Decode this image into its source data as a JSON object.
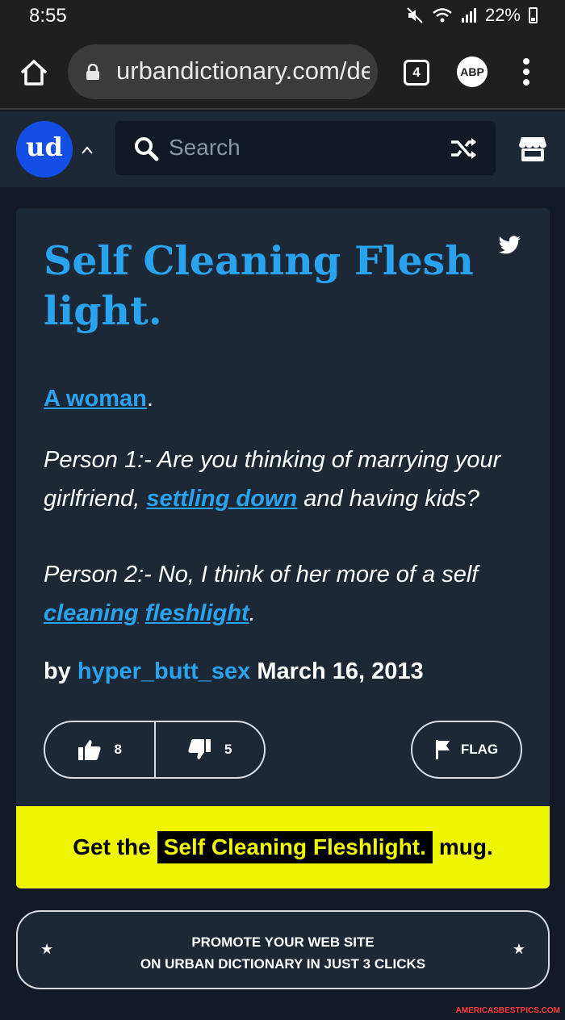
{
  "status_bar": {
    "time": "8:55",
    "battery": "22%"
  },
  "browser": {
    "url": "urbandictionary.com/de",
    "tab_count": "4",
    "abp_label": "ABP"
  },
  "header": {
    "logo": "ud",
    "search_placeholder": "Search"
  },
  "definition": {
    "title": "Self Cleaning Fleshlight.",
    "meaning_link": "A woman",
    "meaning_suffix": ".",
    "example": {
      "line1_prefix": "Person 1:- Are you thinking of marrying your girlfriend, ",
      "line1_link": "settling down",
      "line1_suffix": " and having kids?",
      "line2_prefix": "Person 2:- No, I think of her more of a self ",
      "line2_link1": "cleaning",
      "line2_space": " ",
      "line2_link2": "fleshlight",
      "line2_suffix": "."
    },
    "byline_prefix": "by ",
    "author": "hyper_butt_sex",
    "date": "March 16, 2013",
    "upvotes": "8",
    "downvotes": "5",
    "flag_label": "FLAG"
  },
  "mug": {
    "prefix": "Get the",
    "word": "Self Cleaning Fleshlight.",
    "suffix": "mug."
  },
  "promote": {
    "line1": "PROMOTE YOUR WEB SITE",
    "line2": "ON URBAN DICTIONARY IN JUST 3 CLICKS",
    "star": "★"
  },
  "watermark": "AMERICASBESTPICS.COM",
  "colors": {
    "accent": "#2aa3ef",
    "banner": "#eff700",
    "logo": "#134fe6",
    "card": "#1d2837"
  }
}
